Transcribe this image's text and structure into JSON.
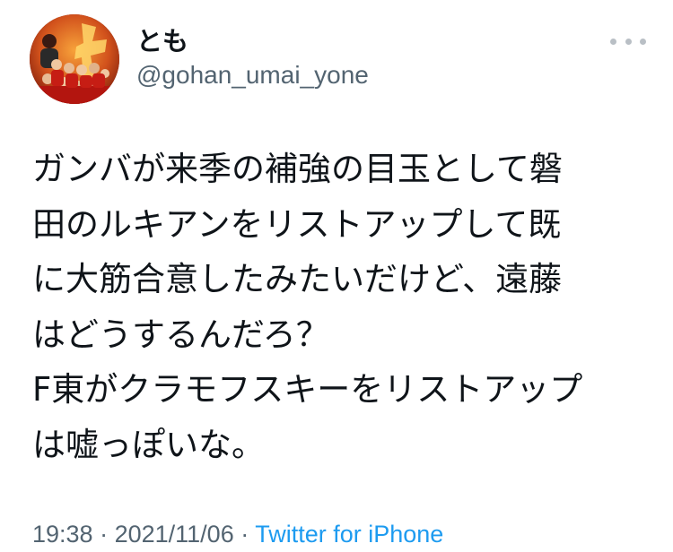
{
  "user": {
    "display_name": "とも",
    "handle": "@gohan_umai_yone",
    "avatar_icon": "team-photo-avatar"
  },
  "tweet": {
    "lines": [
      "ガンバが来季の補強の目玉として磐",
      "田のルキアンをリストアップして既",
      "に大筋合意したみたいだけど、遠藤",
      "はどうするんだろ？",
      "F東がクラモフスキーをリストアップ",
      "は嘘っぽいな。"
    ],
    "time": "19:38",
    "separator": " · ",
    "date": "2021/11/06",
    "source": "Twitter for iPhone"
  },
  "colors": {
    "text": "#0f1419",
    "secondary": "#536471",
    "link": "#1d9bf0",
    "more_dots": "#b9bfc5"
  },
  "icons": {
    "more": "more-dots-icon"
  }
}
